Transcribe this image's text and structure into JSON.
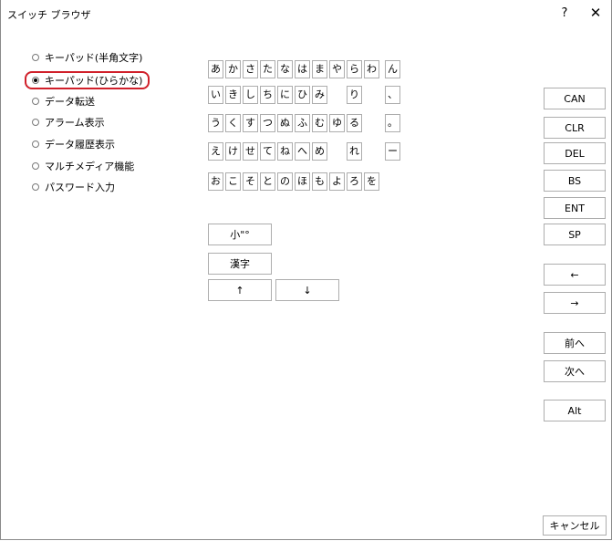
{
  "window": {
    "title": "スイッチ ブラウザ",
    "help": "?",
    "close": "✕"
  },
  "radios": [
    {
      "label": "キーパッド(半角文字)",
      "selected": false
    },
    {
      "label": "キーパッド(ひらかな)",
      "selected": true
    },
    {
      "label": "データ転送",
      "selected": false
    },
    {
      "label": "アラーム表示",
      "selected": false
    },
    {
      "label": "データ履歴表示",
      "selected": false
    },
    {
      "label": "マルチメディア機能",
      "selected": false
    },
    {
      "label": "パスワード入力",
      "selected": false
    }
  ],
  "kana_rows": [
    [
      "あ",
      "か",
      "さ",
      "た",
      "な",
      "は",
      "ま",
      "や",
      "ら",
      "わ",
      "ん"
    ],
    [
      "い",
      "き",
      "し",
      "ち",
      "に",
      "ひ",
      "み",
      "",
      "り",
      "",
      "、"
    ],
    [
      "う",
      "く",
      "す",
      "つ",
      "ぬ",
      "ふ",
      "む",
      "ゆ",
      "る",
      "",
      "。"
    ],
    [
      "え",
      "け",
      "せ",
      "て",
      "ね",
      "へ",
      "め",
      "",
      "れ",
      "",
      "ー"
    ],
    [
      "お",
      "こ",
      "そ",
      "と",
      "の",
      "ほ",
      "も",
      "よ",
      "ろ",
      "を",
      ""
    ]
  ],
  "buttons": {
    "small": "小\"°",
    "kanji": "漢字",
    "up": "↑",
    "down": "↓",
    "can": "CAN",
    "clr": "CLR",
    "del": "DEL",
    "bs": "BS",
    "ent": "ENT",
    "sp": "SP",
    "left": "←",
    "right": "→",
    "prev": "前へ",
    "next": "次へ",
    "alt": "Alt",
    "cancel": "キャンセル"
  }
}
